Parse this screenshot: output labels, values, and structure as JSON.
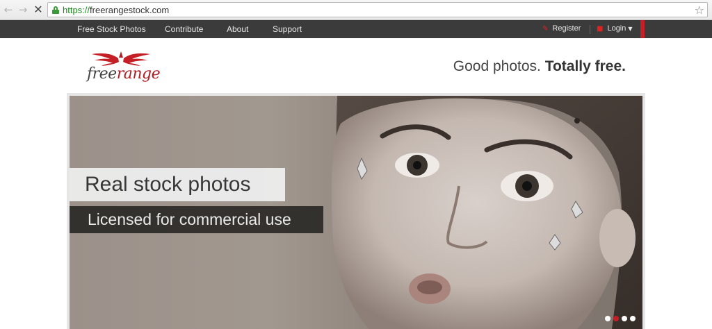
{
  "browser": {
    "url_scheme": "https://",
    "url_host": "freerangestock.com"
  },
  "nav": {
    "links": [
      "Free Stock Photos",
      "Contribute",
      "About",
      "Support"
    ],
    "register": "Register",
    "login": "Login"
  },
  "header": {
    "logo_part1": "free",
    "logo_part2": "range",
    "tagline_light": "Good photos.",
    "tagline_bold": "Totally free."
  },
  "hero": {
    "headline": "Real stock photos",
    "subline": "Licensed for commercial use",
    "active_slide": 2,
    "slide_count": 4
  },
  "colors": {
    "brand_red": "#c51f26",
    "nav_bg": "#3b3b3b",
    "lock_green": "#3a9a3a"
  },
  "icons": {
    "back": "arrow-left-icon",
    "forward": "arrow-right-icon",
    "stop": "close-icon",
    "secure": "lock-icon",
    "bookmark": "star-icon",
    "register": "pencil-icon",
    "login": "lock-icon",
    "dropdown": "caret-down-icon"
  }
}
